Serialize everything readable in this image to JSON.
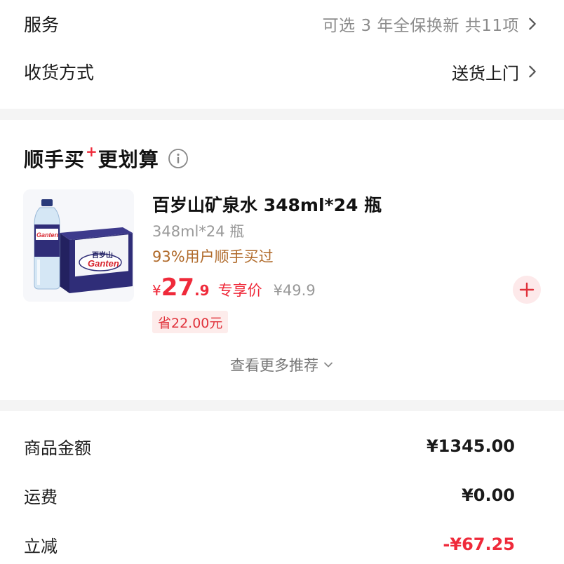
{
  "service": {
    "label": "服务",
    "value": "可选 3 年全保换新 共11项"
  },
  "delivery": {
    "label": "收货方式",
    "value": "送货上门"
  },
  "recommend": {
    "title_part1": "顺手买",
    "title_plus": "+",
    "title_part2": "更划算",
    "product": {
      "name": "百岁山矿泉水 348ml*24 瓶",
      "spec": "348ml*24 瓶",
      "bought_text": "93%用户顺手买过",
      "currency": "¥",
      "price_int": "27",
      "price_dec": ".9",
      "exclusive_label": "专享价",
      "original_price": "¥49.9",
      "save_badge": "省22.00元",
      "image_labels": {
        "brand_cn": "百岁山",
        "brand_en": "Ganten"
      }
    },
    "more_label": "查看更多推荐"
  },
  "summary": {
    "rows": [
      {
        "label": "商品金额",
        "value": "¥1345.00"
      },
      {
        "label": "运费",
        "value": "¥0.00"
      },
      {
        "label": "立减",
        "value": "-¥67.25"
      }
    ]
  },
  "colors": {
    "accent": "#ef2a3a",
    "muted": "#8c8c8c",
    "bought": "#b06a2a",
    "divider": "#f4f4f4"
  }
}
